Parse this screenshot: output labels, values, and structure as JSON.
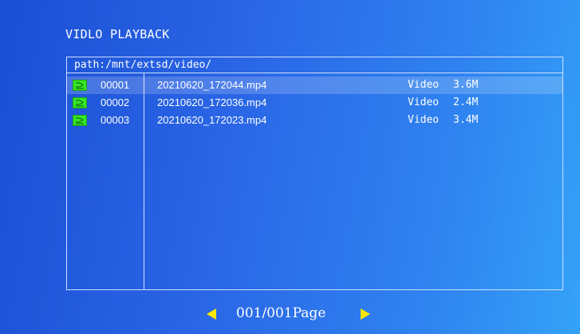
{
  "header": {
    "title": "VIDLO PLAYBACK"
  },
  "browser": {
    "path": "path:/mnt/extsd/video/",
    "files": [
      {
        "icon": "video-file-icon",
        "index": "00001",
        "name": "20210620_172044.mp4",
        "type": "Video",
        "size": "3.6M",
        "selected": true
      },
      {
        "icon": "video-file-icon",
        "index": "00002",
        "name": "20210620_172036.mp4",
        "type": "Video",
        "size": "2.4M",
        "selected": false
      },
      {
        "icon": "video-file-icon",
        "index": "00003",
        "name": "20210620_172023.mp4",
        "type": "Video",
        "size": "3.4M",
        "selected": false
      }
    ]
  },
  "pager": {
    "label": "001/001Page",
    "prev_icon": "triangle-left-icon",
    "next_icon": "triangle-right-icon"
  },
  "colors": {
    "background_start": "#1b4fd4",
    "background_end": "#34a2f8",
    "frame_line": "#cfe0ff",
    "icon_green": "#36e626",
    "arrow_yellow": "#ffe800",
    "text": "#ffffff"
  }
}
